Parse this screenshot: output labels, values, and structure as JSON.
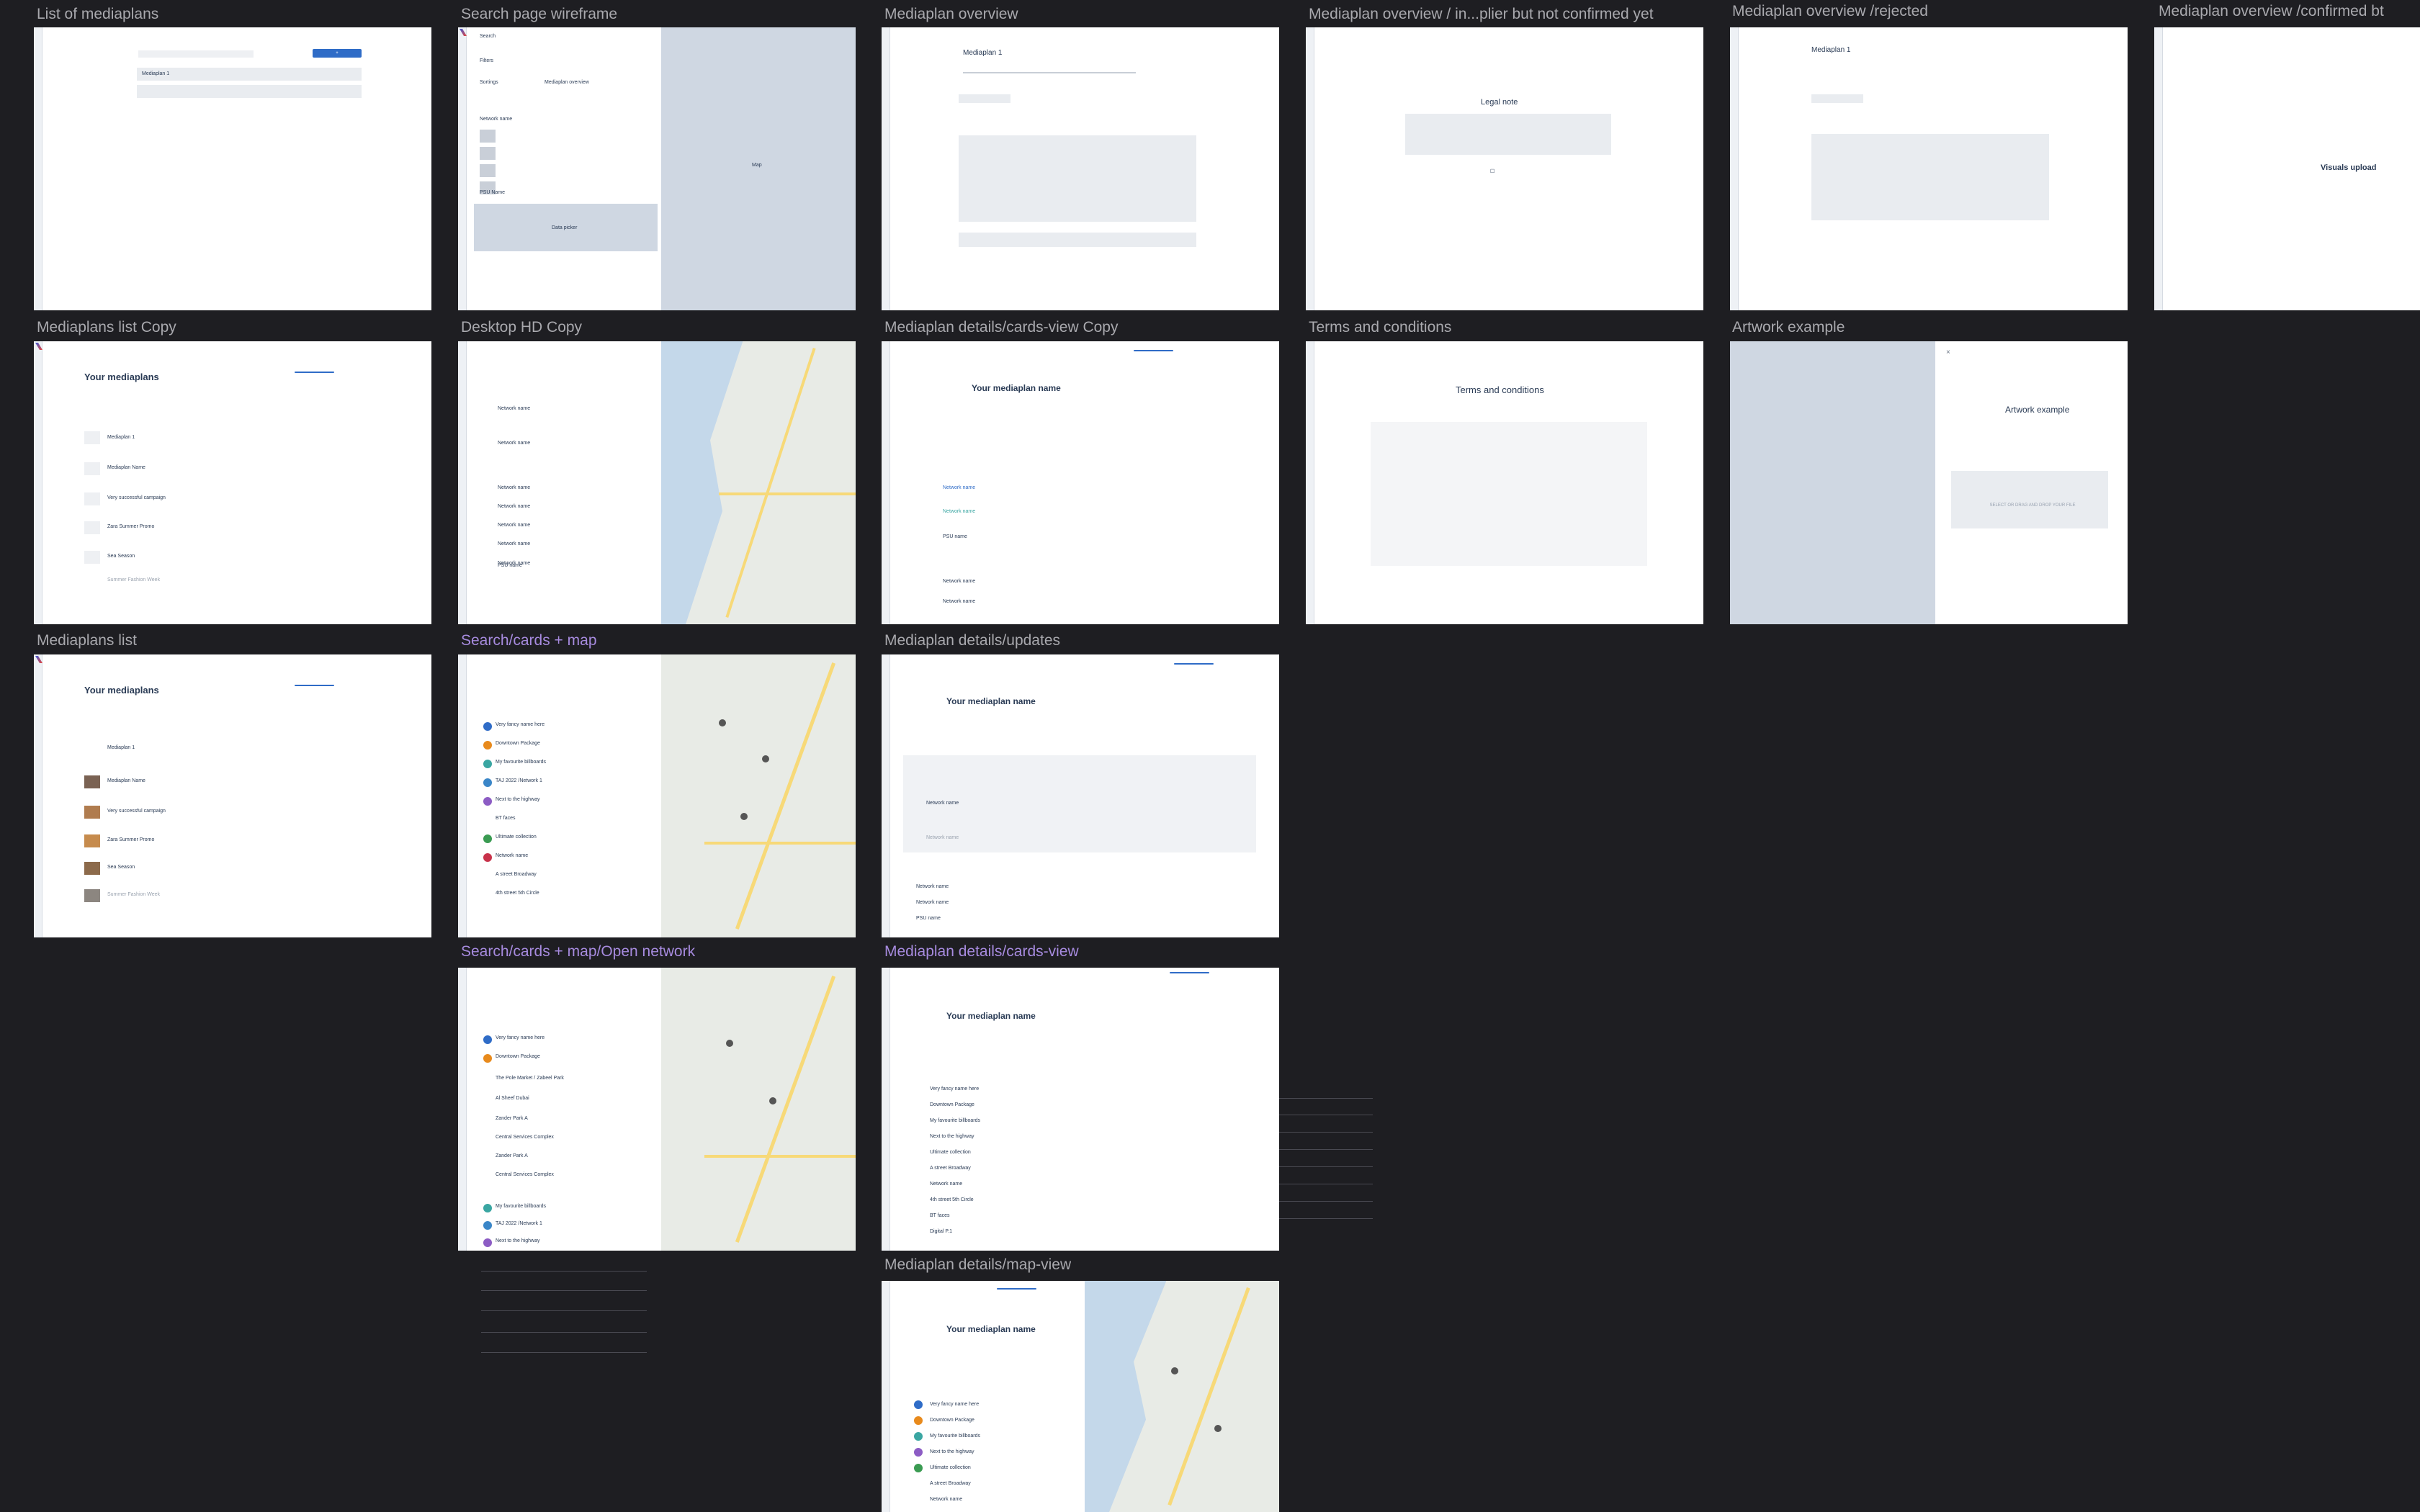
{
  "frames": [
    {
      "label": "List of mediaplans"
    },
    {
      "label": "Search page wireframe"
    },
    {
      "label": "Mediaplan overview"
    },
    {
      "label": "Mediaplan overview / in...plier but not confirmed yet"
    },
    {
      "label": "Mediaplan overview /rejected"
    },
    {
      "label": "Mediaplan overview /confirmed bt"
    },
    {
      "label": "Mediaplans list Copy"
    },
    {
      "label": "Desktop HD Copy"
    },
    {
      "label": "Mediaplan details/cards-view Copy"
    },
    {
      "label": "Terms and conditions"
    },
    {
      "label": "Artwork example"
    },
    {
      "label": "Mediaplans list"
    },
    {
      "label": "Search/cards + map"
    },
    {
      "label": "Mediaplan details/updates"
    },
    {
      "label": "Search/cards + map/Open network"
    },
    {
      "label": "Mediaplan details/cards-view"
    },
    {
      "label": "Mediaplan details/map-view"
    }
  ],
  "content": {
    "wire_search": "Search",
    "wire_filters": "Filters",
    "wire_sorting": "Sortings",
    "wire_mp_overview": "Mediaplan overview",
    "wire_map": "Map",
    "wire_network_name": "Network name",
    "wire_psu_name": "PSU Name",
    "wire_data_picker": "Data picker",
    "mp1": "Mediaplan 1",
    "legal_note": "Legal note",
    "visuals_upload": "Visuals upload",
    "your_mediaplans": "Your mediaplans",
    "your_mediaplan_name": "Your mediaplan name",
    "terms_title": "Terms and conditions",
    "artwork_title": "Artwork example",
    "select_drag": "SELECT OR DRAG AND DROP YOUR FILE",
    "mp_rows": [
      "Mediaplan 1",
      "Mediaplan Name",
      "Very successful campaign",
      "Zara Summer Promo",
      "Sea Season",
      "Summer Fashion Week"
    ],
    "network_rows": [
      "Very fancy name here",
      "Downtown Package",
      "My favourite billboards",
      "TAJ 2022 /Network 1",
      "Next to the highway",
      "BT faces",
      "Ultimate collection",
      "Network name",
      "A street Broadway",
      "4th street 5th Circle",
      "PSU name"
    ],
    "open_network_rows": [
      "The Pole Market / Zabeel Park",
      "Al Sheef Dubai",
      "Zander Park A",
      "Central Services Complex",
      "Zander Park A",
      "Central Services Complex"
    ],
    "detail_rows": [
      "Very fancy name here",
      "Downtown Package",
      "My favourite billboards",
      "Next to the highway",
      "Ultimate collection",
      "A street Broadway",
      "Network name",
      "4th street 5th Circle",
      "BT faces",
      "Digital P.1"
    ]
  }
}
